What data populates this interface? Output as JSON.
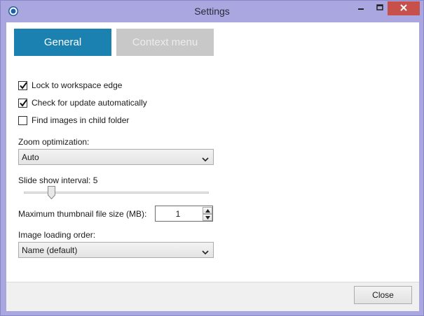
{
  "window": {
    "title": "Settings",
    "app_icon": "app-logo-icon",
    "controls": [
      "minimize-icon",
      "maximize-icon",
      "close-icon"
    ]
  },
  "tabs": [
    {
      "label": "General",
      "active": true
    },
    {
      "label": "Context menu",
      "active": false
    }
  ],
  "options": [
    {
      "label": "Lock to workspace edge",
      "checked": true
    },
    {
      "label": "Check for update automatically",
      "checked": true
    },
    {
      "label": "Find images in child folder",
      "checked": false
    }
  ],
  "zoom": {
    "label": "Zoom optimization:",
    "value": "Auto"
  },
  "slideshow": {
    "label": "Slide show interval: 5",
    "value": 5
  },
  "thumbnail": {
    "label": "Maximum thumbnail file size (MB):",
    "value": "1"
  },
  "loading_order": {
    "label": "Image loading order:",
    "value": "Name (default)"
  },
  "footer": {
    "close_label": "Close"
  },
  "colors": {
    "accent": "#1b81b1",
    "title_bar": "#a9a6e0",
    "close_button": "#c7504b"
  }
}
